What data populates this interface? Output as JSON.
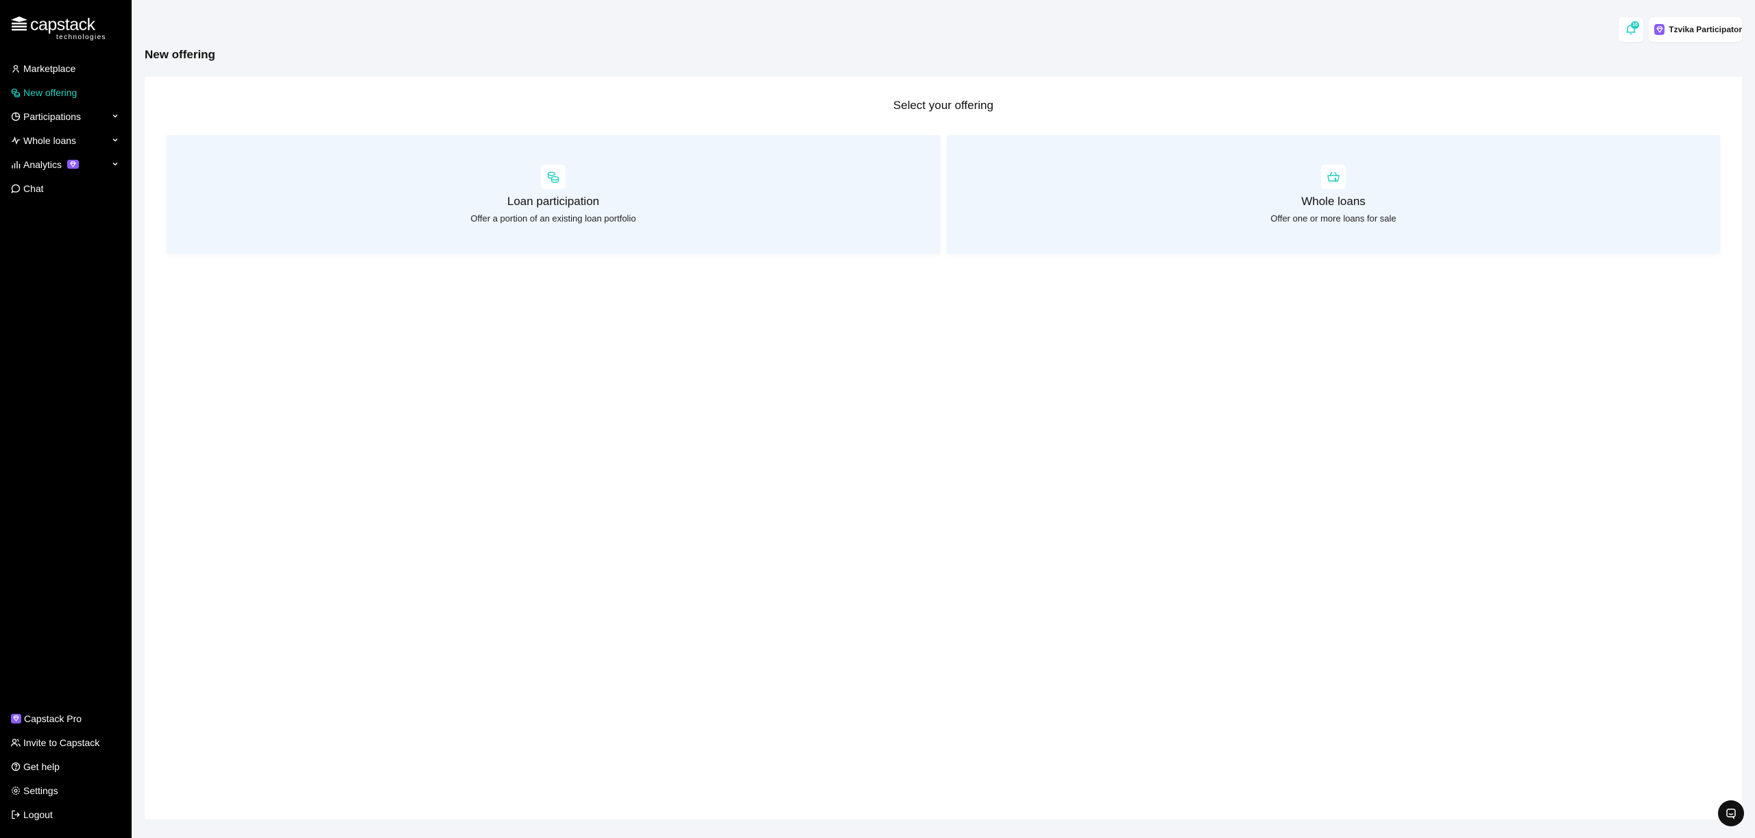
{
  "brand": {
    "name": "capstack",
    "tagline": "technologies"
  },
  "sidebar": {
    "items": [
      {
        "label": "Marketplace"
      },
      {
        "label": "New offering"
      },
      {
        "label": "Participations"
      },
      {
        "label": "Whole loans"
      },
      {
        "label": "Analytics"
      },
      {
        "label": "Chat"
      }
    ],
    "bottom": [
      {
        "label": "Capstack Pro"
      },
      {
        "label": "Invite to Capstack"
      },
      {
        "label": "Get help"
      },
      {
        "label": "Settings"
      },
      {
        "label": "Logout"
      }
    ]
  },
  "header": {
    "notification_count": "10",
    "user_name": "Tzvika Participator"
  },
  "page": {
    "title": "New offering",
    "section_title": "Select your offering",
    "options": [
      {
        "title": "Loan participation",
        "description": "Offer a portion of an existing loan portfolio",
        "icon": "coins-icon"
      },
      {
        "title": "Whole loans",
        "description": "Offer one or more loans for sale",
        "icon": "basket-dollar-icon"
      }
    ]
  },
  "colors": {
    "accent": "#1fd0bf",
    "pro": "#8b5cf6",
    "card": "#eff6fe",
    "sidebar": "#000000"
  }
}
